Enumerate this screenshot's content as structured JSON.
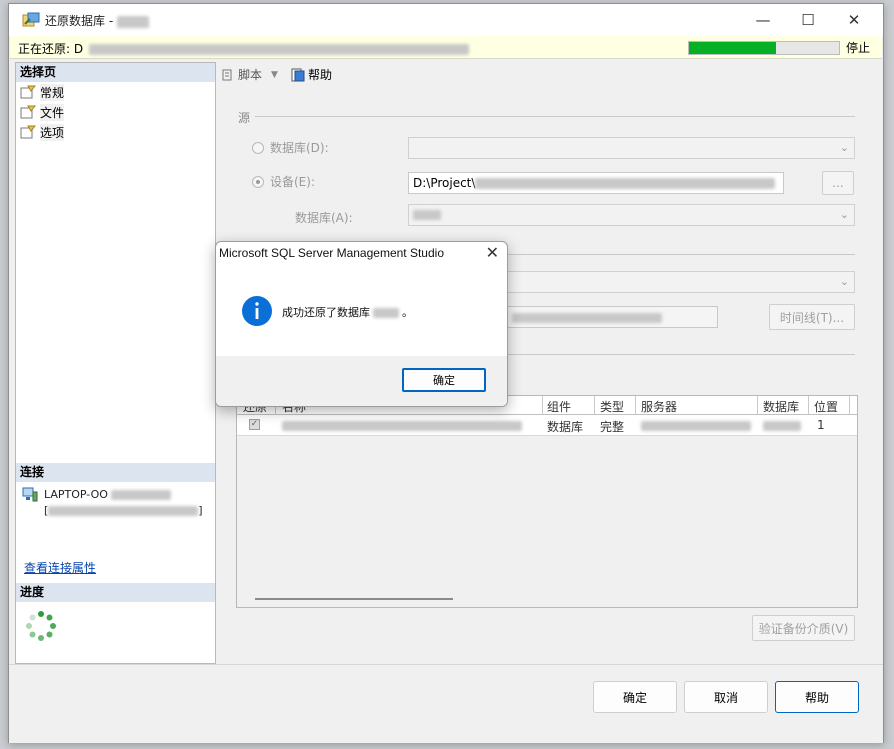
{
  "window": {
    "title": "还原数据库 -"
  },
  "status": {
    "text": "正在还原: D",
    "progress_percent": 58,
    "stop_label": "停止"
  },
  "left": {
    "select_page_header": "选择页",
    "pages": [
      {
        "label": "常规"
      },
      {
        "label": "文件"
      },
      {
        "label": "选项"
      }
    ],
    "connection_header": "连接",
    "connection_text": "LAPTOP-OO",
    "view_props_link": "查看连接属性",
    "progress_header": "进度"
  },
  "toolbar": {
    "script_label": "脚本",
    "help_label": "帮助"
  },
  "source": {
    "group_label": "源",
    "database_radio": "数据库(D):",
    "device_radio": "设备(E):",
    "device_path": "D:\\Project\\",
    "browse_label": "...",
    "database_label": "数据库(A):"
  },
  "destination": {
    "timeline_label": "时间线(T)..."
  },
  "grid": {
    "headers": [
      "还原",
      "名称",
      "组件",
      "类型",
      "服务器",
      "数据库",
      "位置"
    ],
    "row": {
      "component": "数据库",
      "type": "完整",
      "position": "1"
    }
  },
  "verify_label": "验证备份介质(V)",
  "buttons": {
    "ok": "确定",
    "cancel": "取消",
    "help": "帮助"
  },
  "dialog": {
    "title": "Microsoft SQL Server Management Studio",
    "message": "成功还原了数据库",
    "message_end": "。",
    "ok": "确定"
  },
  "colors": {
    "progress": "#06b025",
    "accent": "#0067c0",
    "info": "#0a6fd6"
  }
}
